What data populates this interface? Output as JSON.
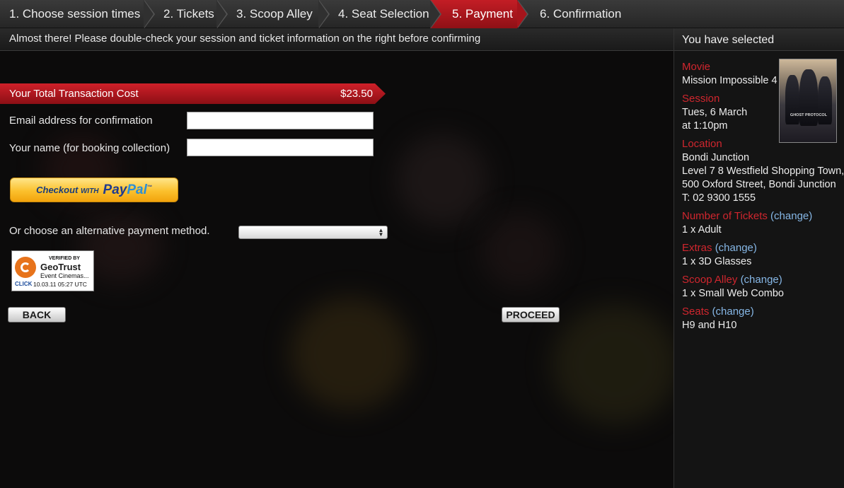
{
  "steps": [
    {
      "label": "1. Choose session times",
      "active": false
    },
    {
      "label": "2. Tickets",
      "active": false
    },
    {
      "label": "3. Scoop Alley",
      "active": false
    },
    {
      "label": "4. Seat Selection",
      "active": false
    },
    {
      "label": "5. Payment",
      "active": true
    },
    {
      "label": "6. Confirmation",
      "active": false
    }
  ],
  "notice": "Almost there! Please double-check your session and ticket information on the right before confirming",
  "total": {
    "label": "Your Total Transaction Cost",
    "amount": "$23.50"
  },
  "form": {
    "email_label": "Email address for confirmation",
    "email_value": "",
    "name_label": "Your name (for booking collection)",
    "name_value": ""
  },
  "paypal": {
    "checkout": "Checkout",
    "with": "WITH",
    "pay": "Pay",
    "pal": "Pal"
  },
  "alt_payment": {
    "label": "Or choose an alternative payment method.",
    "selected": ""
  },
  "geotrust": {
    "verified": "VERIFIED BY",
    "brand": "GeoTrust",
    "name": "Event Cinemas...",
    "click": "CLICK",
    "timestamp": "10.03.11 05:27 UTC"
  },
  "buttons": {
    "back": "BACK",
    "proceed": "PROCEED"
  },
  "sidebar": {
    "heading": "You have selected",
    "poster_title": "GHOST PROTOCOL",
    "movie_label": "Movie",
    "movie": "Mission Impossible 4",
    "session_label": "Session",
    "session_date": "Tues, 6 March",
    "session_time": "at 1:10pm",
    "location_label": "Location",
    "location_lines": [
      "Bondi Junction",
      "Level 7 8 Westfield Shopping Town,",
      "500 Oxford Street, Bondi Junction",
      "T: 02 9300 1555"
    ],
    "tickets_label": "Number of Tickets",
    "tickets": "1 x Adult",
    "extras_label": "Extras",
    "extras": "1 x 3D Glasses",
    "scoop_label": "Scoop Alley",
    "scoop": "1 x Small Web Combo",
    "seats_label": "Seats",
    "seats": "H9 and H10",
    "change": "(change)"
  }
}
